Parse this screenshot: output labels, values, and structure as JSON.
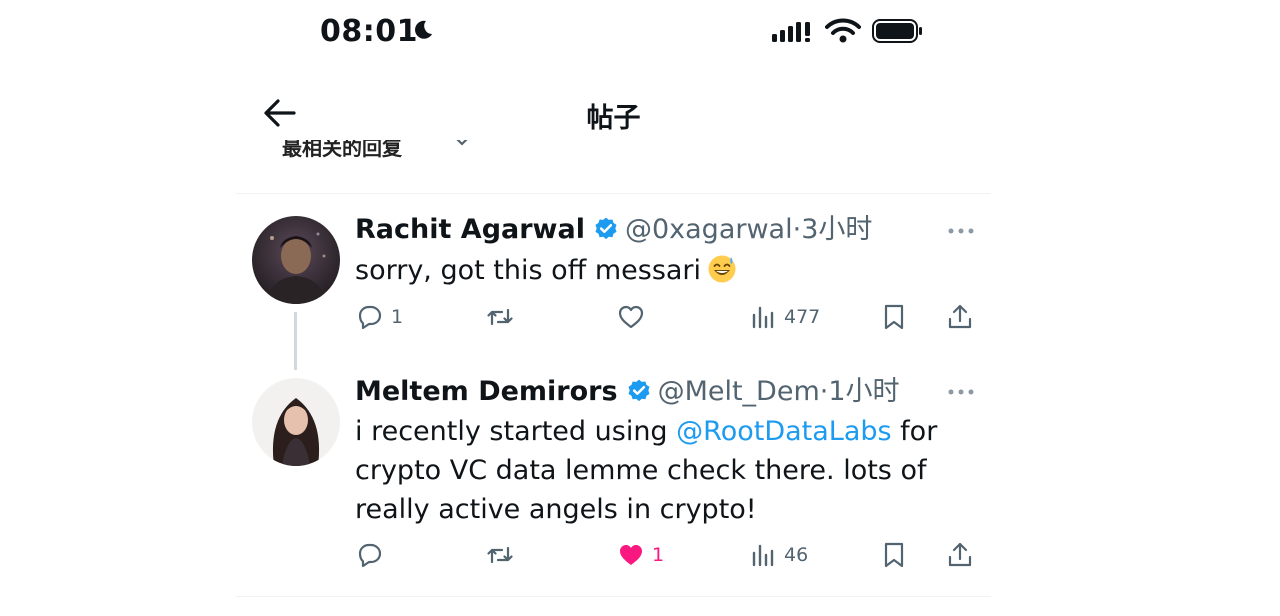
{
  "status_bar": {
    "time": "08:01"
  },
  "nav": {
    "title": "帖子"
  },
  "sort": {
    "label": "最相关的回复"
  },
  "tweets": [
    {
      "name": "Rachit Agarwal",
      "handle": "@0xagarwal",
      "dot": "·",
      "time": "3小时",
      "text": "sorry, got this off messari",
      "emoji": "grinning-sweat-emoji",
      "actions": {
        "reply": "1",
        "retweet": "",
        "like": "",
        "views": "477"
      }
    },
    {
      "name": "Meltem Demirors",
      "handle": "@Melt_Dem",
      "dot": "·",
      "time": "1小时",
      "text_before": "i recently started using ",
      "mention": "@RootDataLabs",
      "text_after": " for crypto VC data lemme check there. lots of really active angels in crypto!",
      "actions": {
        "reply": "",
        "retweet": "",
        "like": "1",
        "views": "46",
        "liked": true
      }
    }
  ],
  "colors": {
    "accent": "#1d9bf0",
    "like": "#f91880",
    "secondary_text": "#536471",
    "primary_text": "#0f1419",
    "divider": "#eff3f4"
  }
}
